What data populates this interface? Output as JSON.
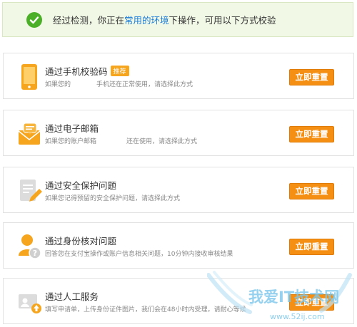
{
  "banner": {
    "text_before": "经过检测，你正在",
    "link_text": "常用的环境",
    "text_after": "下操作，可用以下方式校验"
  },
  "options": [
    {
      "title": "通过手机校验码",
      "badge": "推荐",
      "desc_left": "如果您的",
      "desc_right": "手机还在正常使用，请选择此方式",
      "button": "立即重置",
      "icon": "phone-icon"
    },
    {
      "title": "通过电子邮箱",
      "desc_left": "如果您的账户邮箱",
      "desc_right": "还在使用，请选择此方式",
      "button": "立即重置",
      "icon": "mail-icon"
    },
    {
      "title": "通过安全保护问题",
      "desc": "如果您记得预留的安全保护问题，请选择此方式",
      "button": "立即重置",
      "icon": "edit-document-icon"
    },
    {
      "title": "通过身份核对问题",
      "desc": "回答您在支付宝操作或账户信息相关问题，10分钟内接收审核结果",
      "button": "立即重置",
      "icon": "user-question-icon"
    },
    {
      "title": "通过人工服务",
      "desc": "填写申请单，上传身份证件图片，我们会在48小时内受理，请耐心等候",
      "button": "立即重置",
      "icon": "upload-id-icon"
    }
  ],
  "watermark": {
    "text": "我爱IT技术网",
    "url": "www.52ij.com"
  }
}
